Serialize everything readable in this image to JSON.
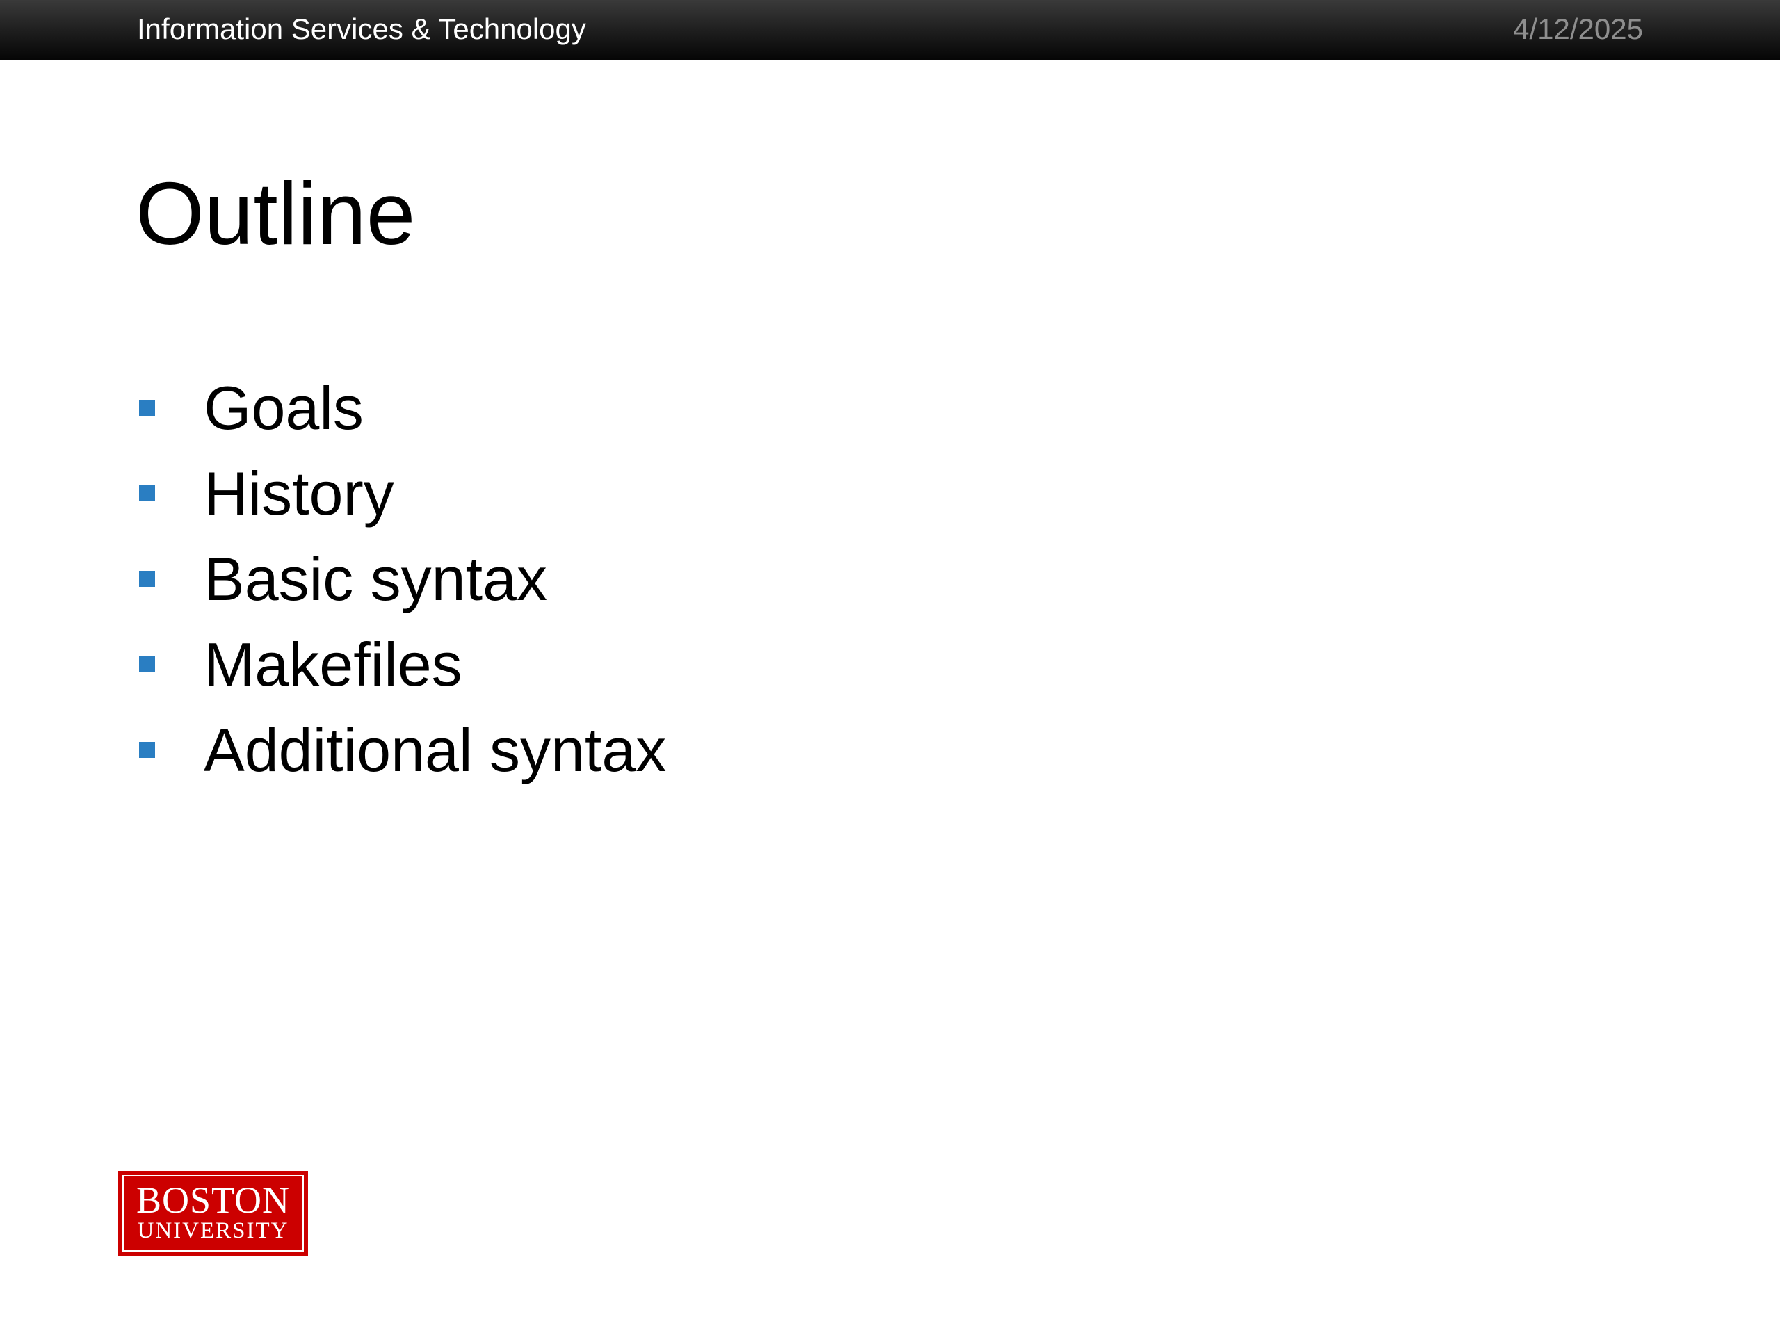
{
  "header": {
    "organization": "Information Services & Technology",
    "date": "4/12/2025"
  },
  "slide": {
    "title": "Outline",
    "items": [
      {
        "label": "Goals"
      },
      {
        "label": "History"
      },
      {
        "label": "Basic syntax"
      },
      {
        "label": "Makefiles"
      },
      {
        "label": "Additional syntax"
      }
    ]
  },
  "logo": {
    "line1": "BOSTON",
    "line2": "UNIVERSITY"
  },
  "colors": {
    "bullet": "#2a7ec2",
    "logo_red": "#cc0000",
    "header_bar": "#1c1c1c"
  },
  "icons": {
    "bullet": "square-bullet-icon"
  }
}
